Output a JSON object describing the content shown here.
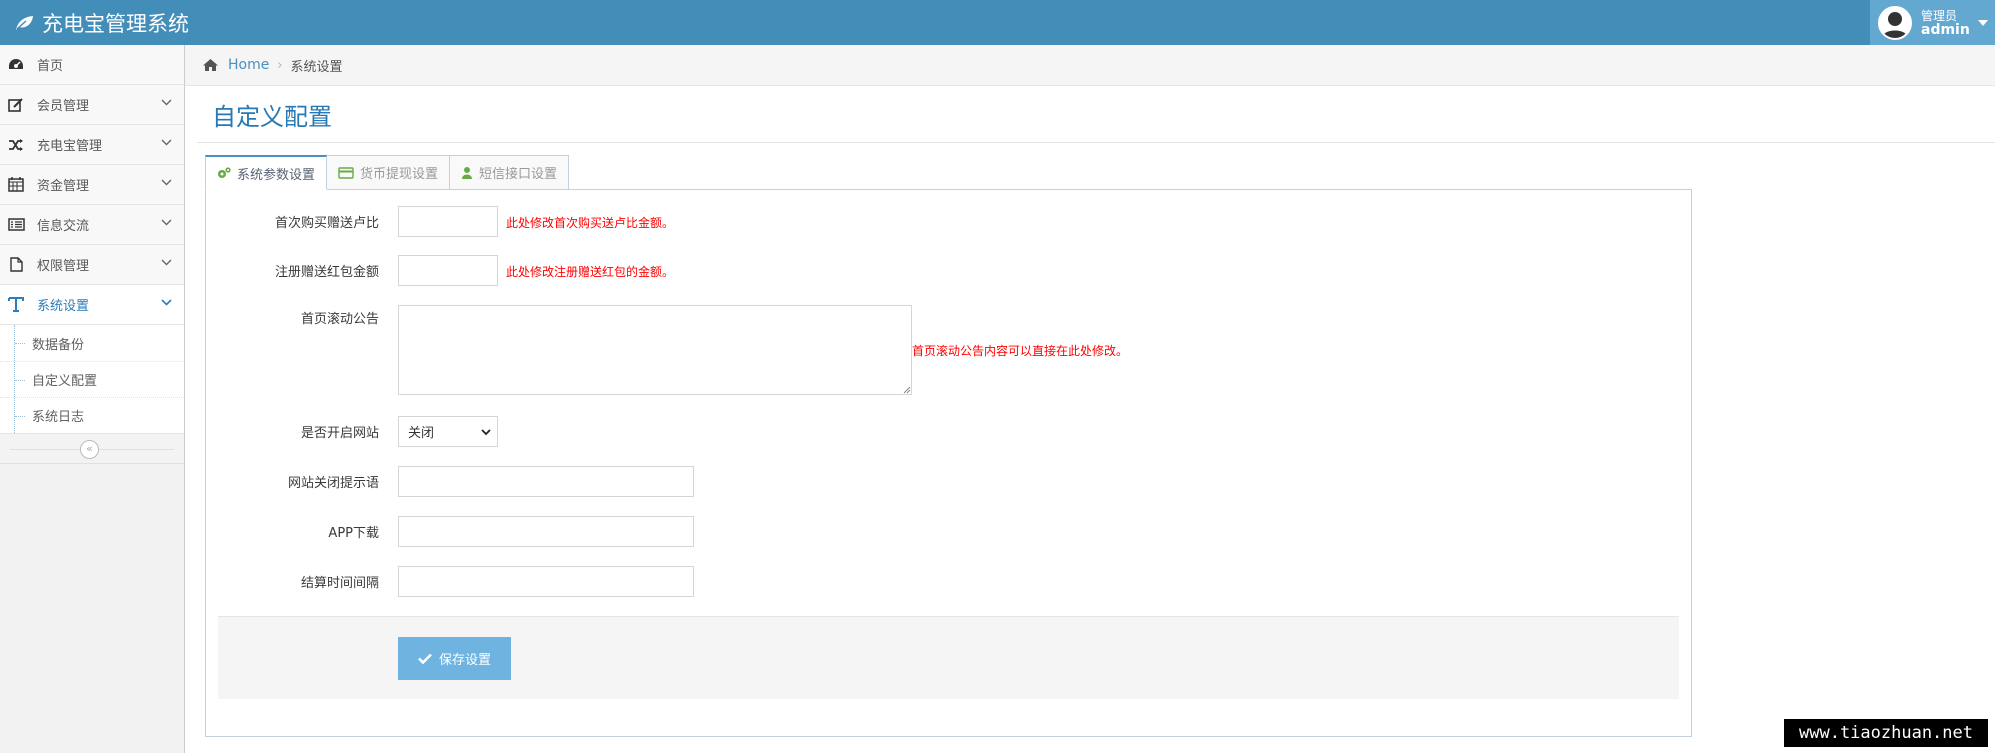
{
  "app": {
    "title": "充电宝管理系统"
  },
  "user": {
    "role": "管理员",
    "name": "admin"
  },
  "sidebar": {
    "items": [
      {
        "label": "首页",
        "icon": "dashboard-icon"
      },
      {
        "label": "会员管理",
        "icon": "edit-icon"
      },
      {
        "label": "充电宝管理",
        "icon": "shuffle-icon"
      },
      {
        "label": "资金管理",
        "icon": "calendar-icon"
      },
      {
        "label": "信息交流",
        "icon": "list-alt-icon"
      },
      {
        "label": "权限管理",
        "icon": "file-icon"
      },
      {
        "label": "系统设置",
        "icon": "text-icon"
      }
    ],
    "sub_items": [
      {
        "label": "数据备份"
      },
      {
        "label": "自定义配置"
      },
      {
        "label": "系统日志"
      }
    ],
    "collapse_glyph": "«"
  },
  "breadcrumb": {
    "home": "Home",
    "current": "系统设置"
  },
  "page": {
    "title": "自定义配置"
  },
  "tabs": [
    {
      "label": "系统参数设置",
      "icon": "cogs-icon"
    },
    {
      "label": "货币提现设置",
      "icon": "credit-card-icon"
    },
    {
      "label": "短信接口设置",
      "icon": "user-icon"
    }
  ],
  "form": {
    "first_buy_ratio": {
      "label": "首次购买赠送卢比",
      "value": "",
      "hint": "此处修改首次购买送卢比金额。"
    },
    "register_bonus": {
      "label": "注册赠送红包金额",
      "value": "",
      "hint": "此处修改注册赠送红包的金额。"
    },
    "announcement": {
      "label": "首页滚动公告",
      "value": "",
      "hint": "首页滚动公告内容可以直接在此处修改。"
    },
    "site_open": {
      "label": "是否开启网站",
      "selected": "关闭"
    },
    "close_notice": {
      "label": "网站关闭提示语",
      "value": ""
    },
    "app_download": {
      "label": "APP下载",
      "value": ""
    },
    "settle_interval": {
      "label": "结算时间间隔",
      "value": ""
    },
    "save_label": "保存设置"
  },
  "watermark": "www.tiaozhuan.net",
  "colors": {
    "navbar": "#438eb9",
    "accent": "#2679b5",
    "hint": "#ff0000",
    "button": "#6fb3e0"
  }
}
